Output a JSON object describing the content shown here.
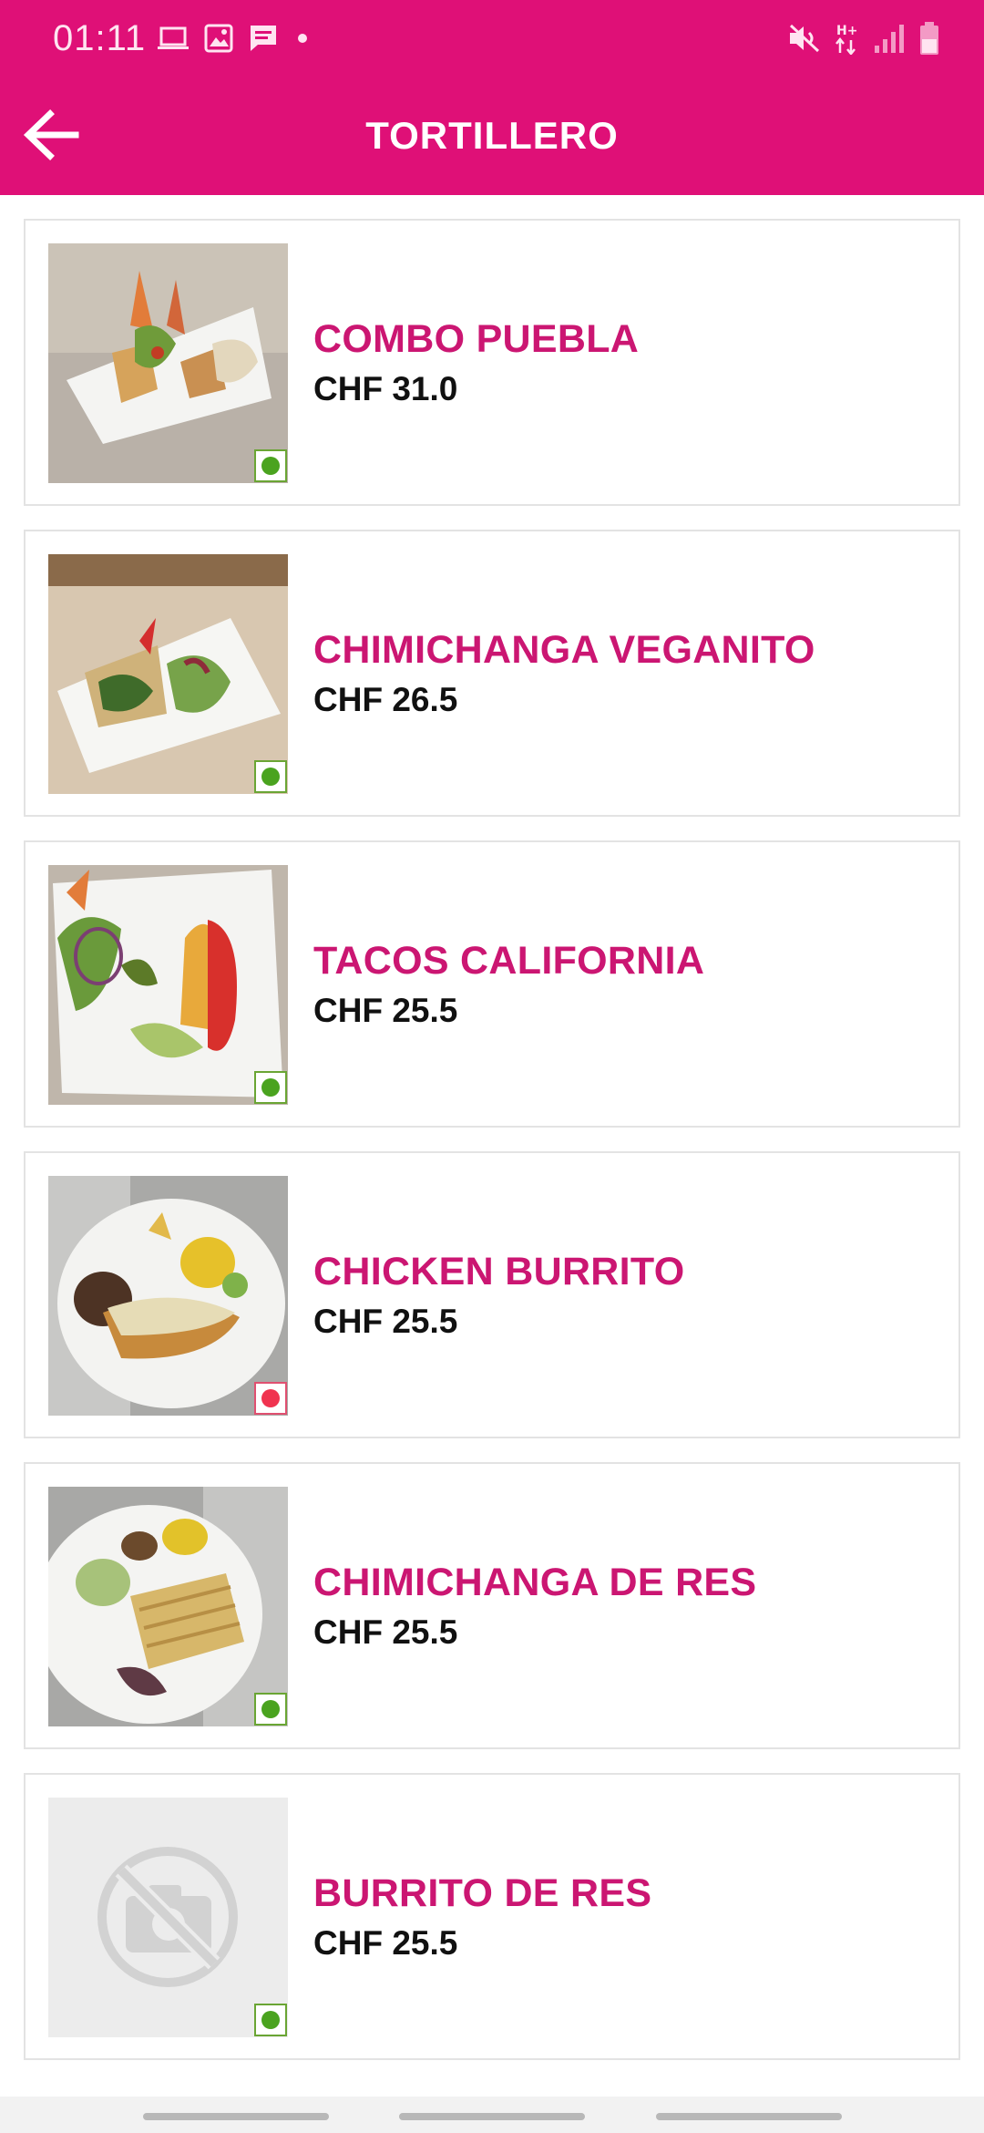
{
  "status_bar": {
    "time": "01:11",
    "left_icons": [
      "laptop-icon",
      "image-icon",
      "message-icon",
      "dot-icon"
    ],
    "right_icons": [
      "mute-icon",
      "network-hplus-icon",
      "signal-icon",
      "battery-icon"
    ]
  },
  "header": {
    "title": "TORTILLERO",
    "back_icon": "arrow-left-icon"
  },
  "colors": {
    "brand": "#DF1077",
    "item_name": "#CB1672",
    "veg_indicator": "#4AA31F",
    "nonveg_indicator": "#F0334F"
  },
  "items": [
    {
      "name": "COMBO PUEBLA",
      "price": "CHF 31.0",
      "diet": "veg"
    },
    {
      "name": "CHIMICHANGA VEGANITO",
      "price": "CHF 26.5",
      "diet": "veg"
    },
    {
      "name": "TACOS CALIFORNIA",
      "price": "CHF 25.5",
      "diet": "veg"
    },
    {
      "name": "CHICKEN BURRITO",
      "price": "CHF 25.5",
      "diet": "non-veg"
    },
    {
      "name": "CHIMICHANGA DE RES",
      "price": "CHF 25.5",
      "diet": "veg"
    },
    {
      "name": "BURRITO DE RES",
      "price": "CHF 25.5",
      "diet": "veg"
    }
  ]
}
